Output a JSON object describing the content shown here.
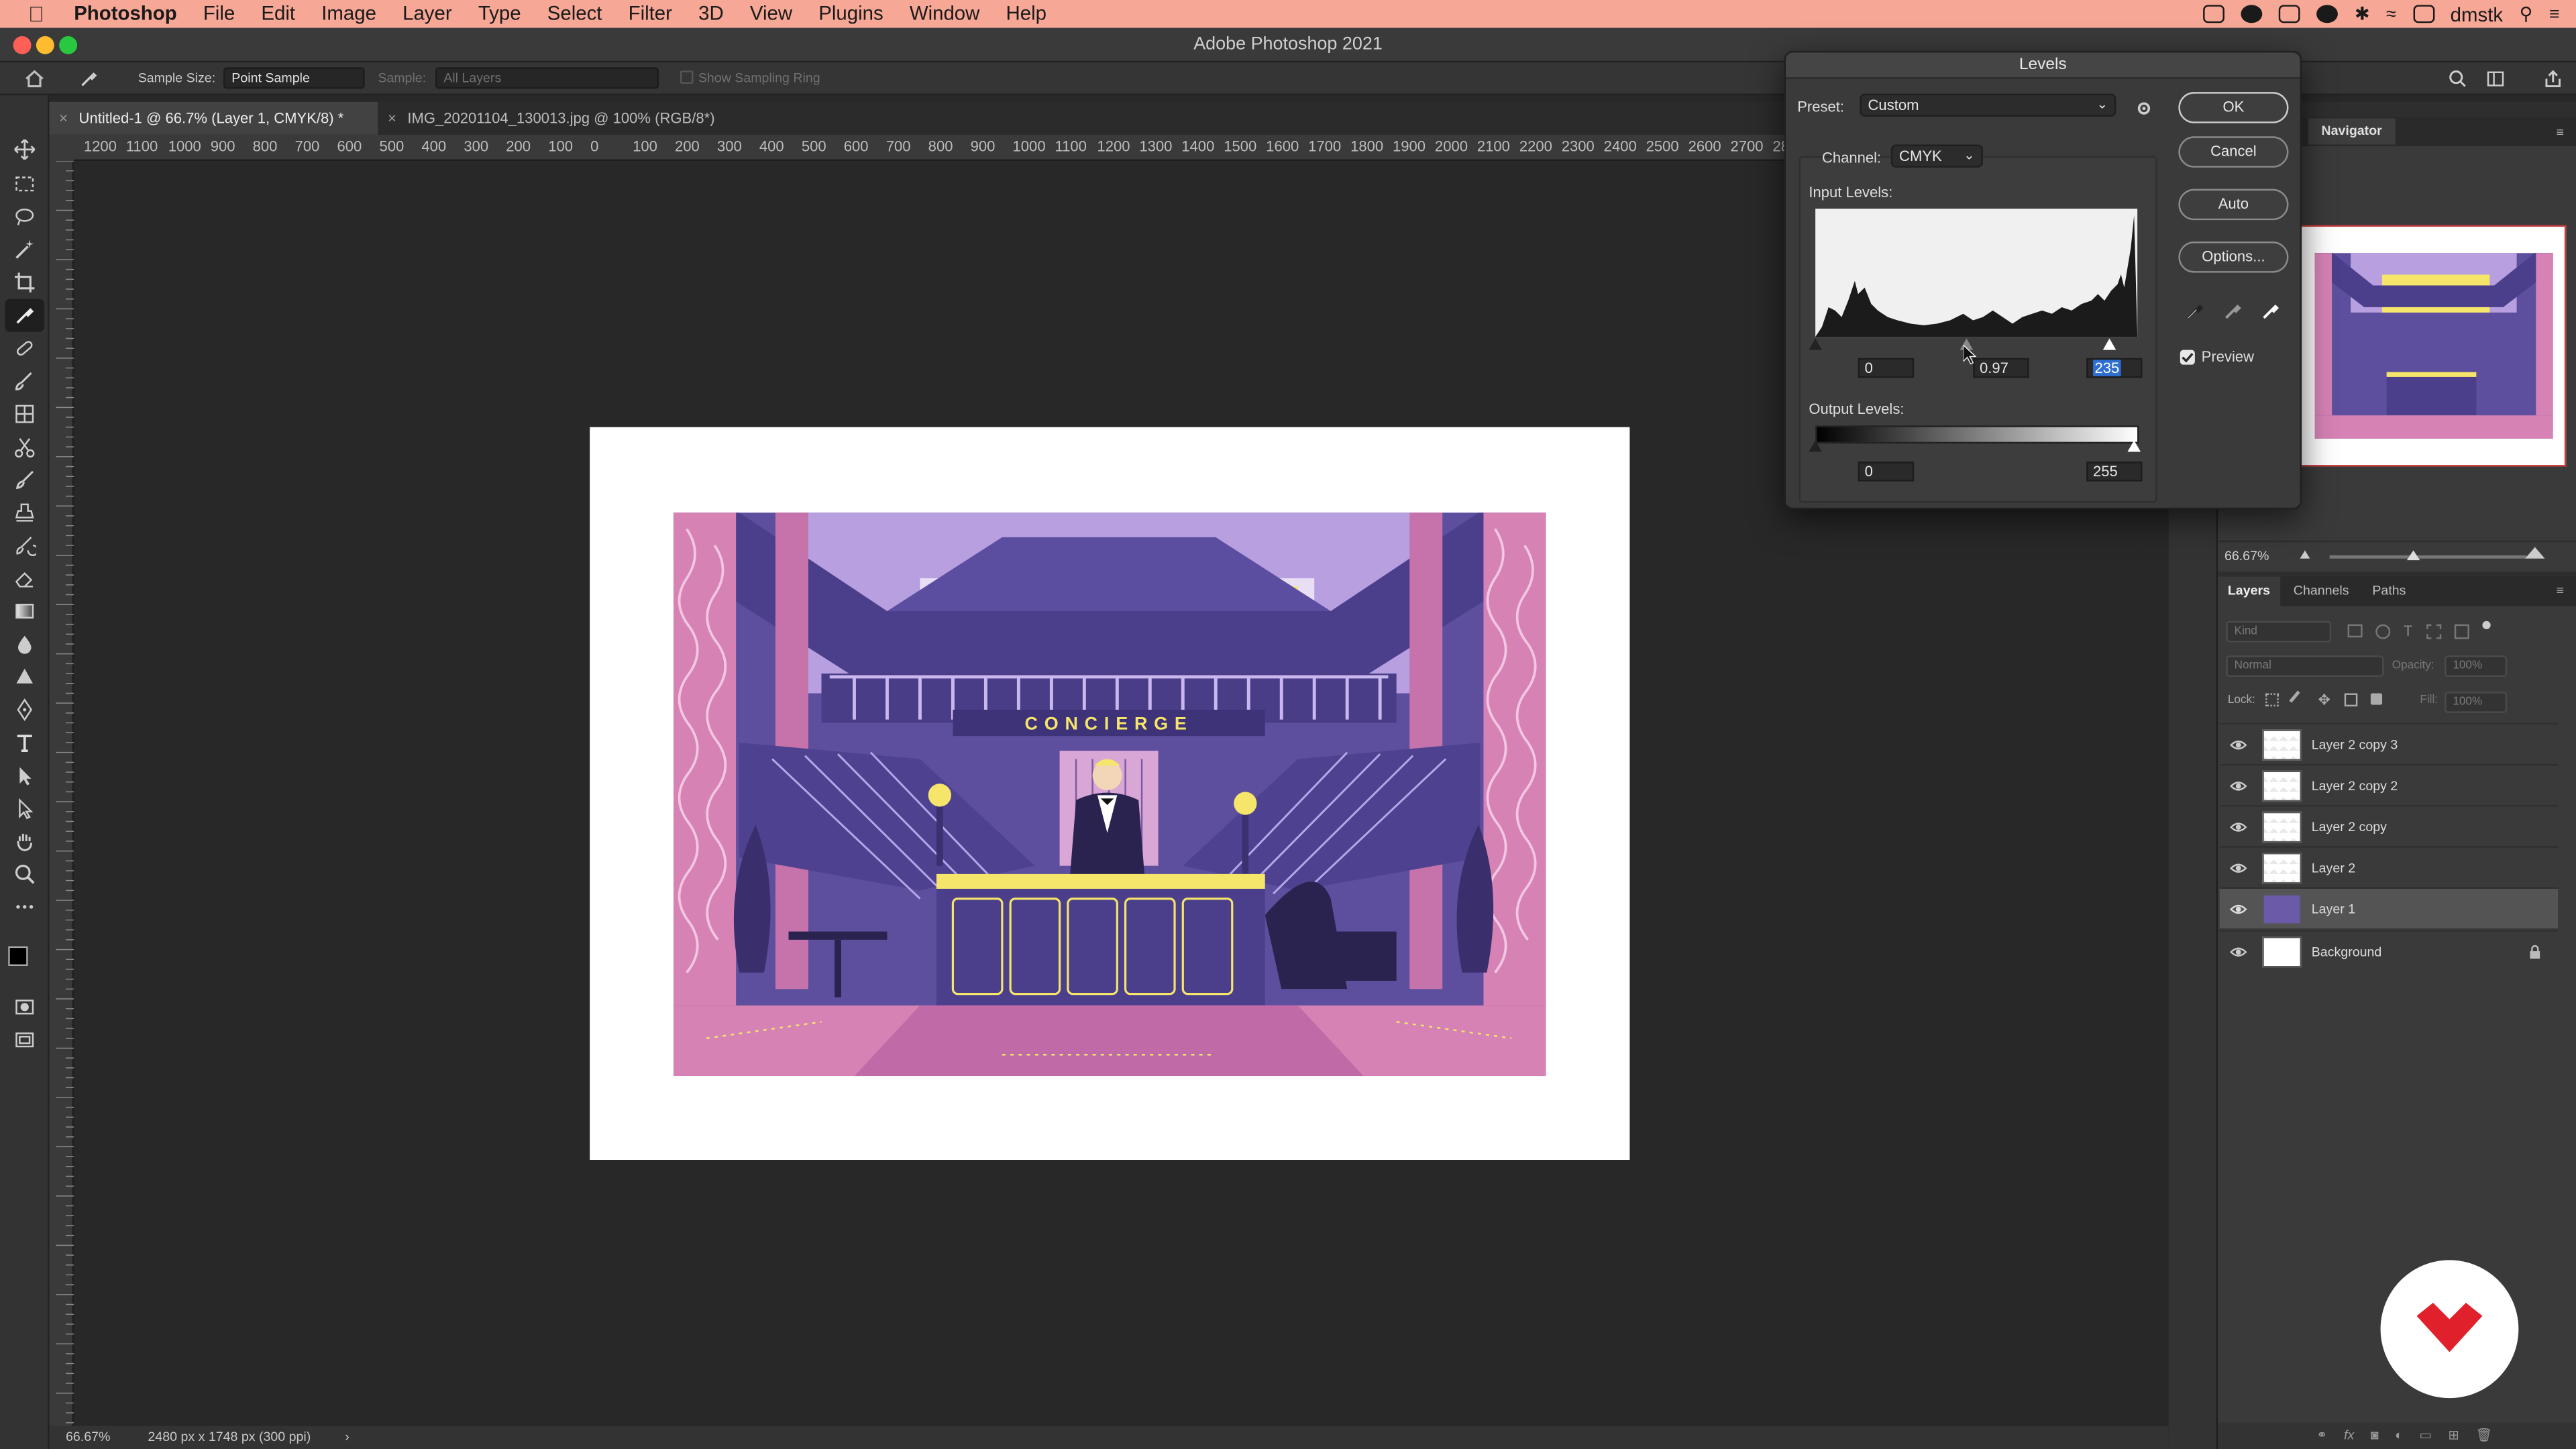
{
  "menubar": {
    "app": "Photoshop",
    "items": [
      "File",
      "Edit",
      "Image",
      "Layer",
      "Type",
      "Select",
      "Filter",
      "3D",
      "View",
      "Plugins",
      "Window",
      "Help"
    ],
    "user": "dmstk"
  },
  "window": {
    "title": "Adobe Photoshop 2021"
  },
  "options": {
    "sample_size_label": "Sample Size:",
    "sample_size_value": "Point Sample",
    "sample_label": "Sample:",
    "sample_value": "All Layers",
    "sampling_ring_label": "Show Sampling Ring"
  },
  "tabs": [
    {
      "label": "Untitled-1 @ 66.7% (Layer 1, CMYK/8) *"
    },
    {
      "label": "IMG_20201104_130013.jpg @ 100% (RGB/8*)"
    }
  ],
  "ruler": {
    "ticks": [
      "1200",
      "1100",
      "1000",
      "900",
      "800",
      "700",
      "600",
      "500",
      "400",
      "300",
      "200",
      "100",
      "0",
      "100",
      "200",
      "300",
      "400",
      "500",
      "600",
      "700",
      "800",
      "900",
      "1000",
      "1100",
      "1200",
      "1300",
      "1400",
      "1500",
      "1600",
      "1700",
      "1800",
      "1900",
      "2000",
      "2100",
      "2200",
      "2300",
      "2400",
      "2500",
      "2600",
      "2700",
      "28"
    ]
  },
  "artwork": {
    "sign_text": "CONCIERGE"
  },
  "status": {
    "zoom": "66.67%",
    "doc_info": "2480 px x 1748 px (300 ppi)"
  },
  "navigator": {
    "tab": "Navigator",
    "zoom": "66.67%"
  },
  "layers_panel": {
    "tabs": [
      "Layers",
      "Channels",
      "Paths"
    ],
    "kind_placeholder": "Kind",
    "blend_mode": "Normal",
    "opacity_label": "Opacity:",
    "opacity_value": "100%",
    "lock_label": "Lock:",
    "fill_label": "Fill:",
    "fill_value": "100%",
    "layers": [
      {
        "name": "Layer 2 copy 3"
      },
      {
        "name": "Layer 2 copy 2"
      },
      {
        "name": "Layer 2 copy"
      },
      {
        "name": "Layer 2"
      },
      {
        "name": "Layer 1"
      },
      {
        "name": "Background"
      }
    ]
  },
  "levels": {
    "title": "Levels",
    "preset_label": "Preset:",
    "preset_value": "Custom",
    "channel_label": "Channel:",
    "channel_value": "CMYK",
    "input_label": "Input Levels:",
    "input_black": "0",
    "input_gamma": "0.97",
    "input_white": "235",
    "output_label": "Output Levels:",
    "output_black": "0",
    "output_white": "255",
    "buttons": {
      "ok": "OK",
      "cancel": "Cancel",
      "auto": "Auto",
      "options": "Options..."
    },
    "preview_label": "Preview",
    "preview_checked": true
  },
  "colors": {
    "menubar_bg": "#f6a795",
    "accent_select": "#2f6fd1",
    "art_purple": "#5e4f9e",
    "art_pink": "#d682b5",
    "art_yellow": "#f5e56b",
    "badge_red": "#e0202a"
  }
}
